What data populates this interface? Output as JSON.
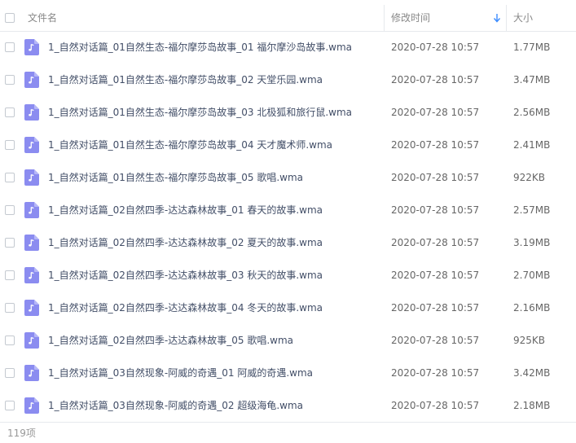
{
  "header": {
    "col_name": "文件名",
    "col_time": "修改时间",
    "col_size": "大小",
    "sort_indicator": "descending"
  },
  "colors": {
    "icon_bg": "#8b8cf0",
    "sort_arrow": "#3b8cff",
    "header_text": "#888888",
    "name_text": "#424e67"
  },
  "icons": {
    "file": "music-note-icon",
    "sort": "sort-down-arrow-icon"
  },
  "files": [
    {
      "name": "1_自然对话篇_01自然生态-福尔摩莎岛故事_01 福尔摩沙岛故事.wma",
      "time": "2020-07-28 10:57",
      "size": "1.77MB"
    },
    {
      "name": "1_自然对话篇_01自然生态-福尔摩莎岛故事_02 天堂乐园.wma",
      "time": "2020-07-28 10:57",
      "size": "3.47MB"
    },
    {
      "name": "1_自然对话篇_01自然生态-福尔摩莎岛故事_03 北极狐和旅行鼠.wma",
      "time": "2020-07-28 10:57",
      "size": "2.56MB"
    },
    {
      "name": "1_自然对话篇_01自然生态-福尔摩莎岛故事_04 天才魔术师.wma",
      "time": "2020-07-28 10:57",
      "size": "2.41MB"
    },
    {
      "name": "1_自然对话篇_01自然生态-福尔摩莎岛故事_05 歌唱.wma",
      "time": "2020-07-28 10:57",
      "size": "922KB"
    },
    {
      "name": "1_自然对话篇_02自然四季-达达森林故事_01 春天的故事.wma",
      "time": "2020-07-28 10:57",
      "size": "2.57MB"
    },
    {
      "name": "1_自然对话篇_02自然四季-达达森林故事_02 夏天的故事.wma",
      "time": "2020-07-28 10:57",
      "size": "3.19MB"
    },
    {
      "name": "1_自然对话篇_02自然四季-达达森林故事_03 秋天的故事.wma",
      "time": "2020-07-28 10:57",
      "size": "2.70MB"
    },
    {
      "name": "1_自然对话篇_02自然四季-达达森林故事_04 冬天的故事.wma",
      "time": "2020-07-28 10:57",
      "size": "2.16MB"
    },
    {
      "name": "1_自然对话篇_02自然四季-达达森林故事_05 歌唱.wma",
      "time": "2020-07-28 10:57",
      "size": "925KB"
    },
    {
      "name": "1_自然对话篇_03自然现象-阿威的奇遇_01 阿威的奇遇.wma",
      "time": "2020-07-28 10:57",
      "size": "3.42MB"
    },
    {
      "name": "1_自然对话篇_03自然现象-阿威的奇遇_02 超级海龟.wma",
      "time": "2020-07-28 10:57",
      "size": "2.18MB"
    }
  ],
  "footer": {
    "item_count": "119项"
  }
}
